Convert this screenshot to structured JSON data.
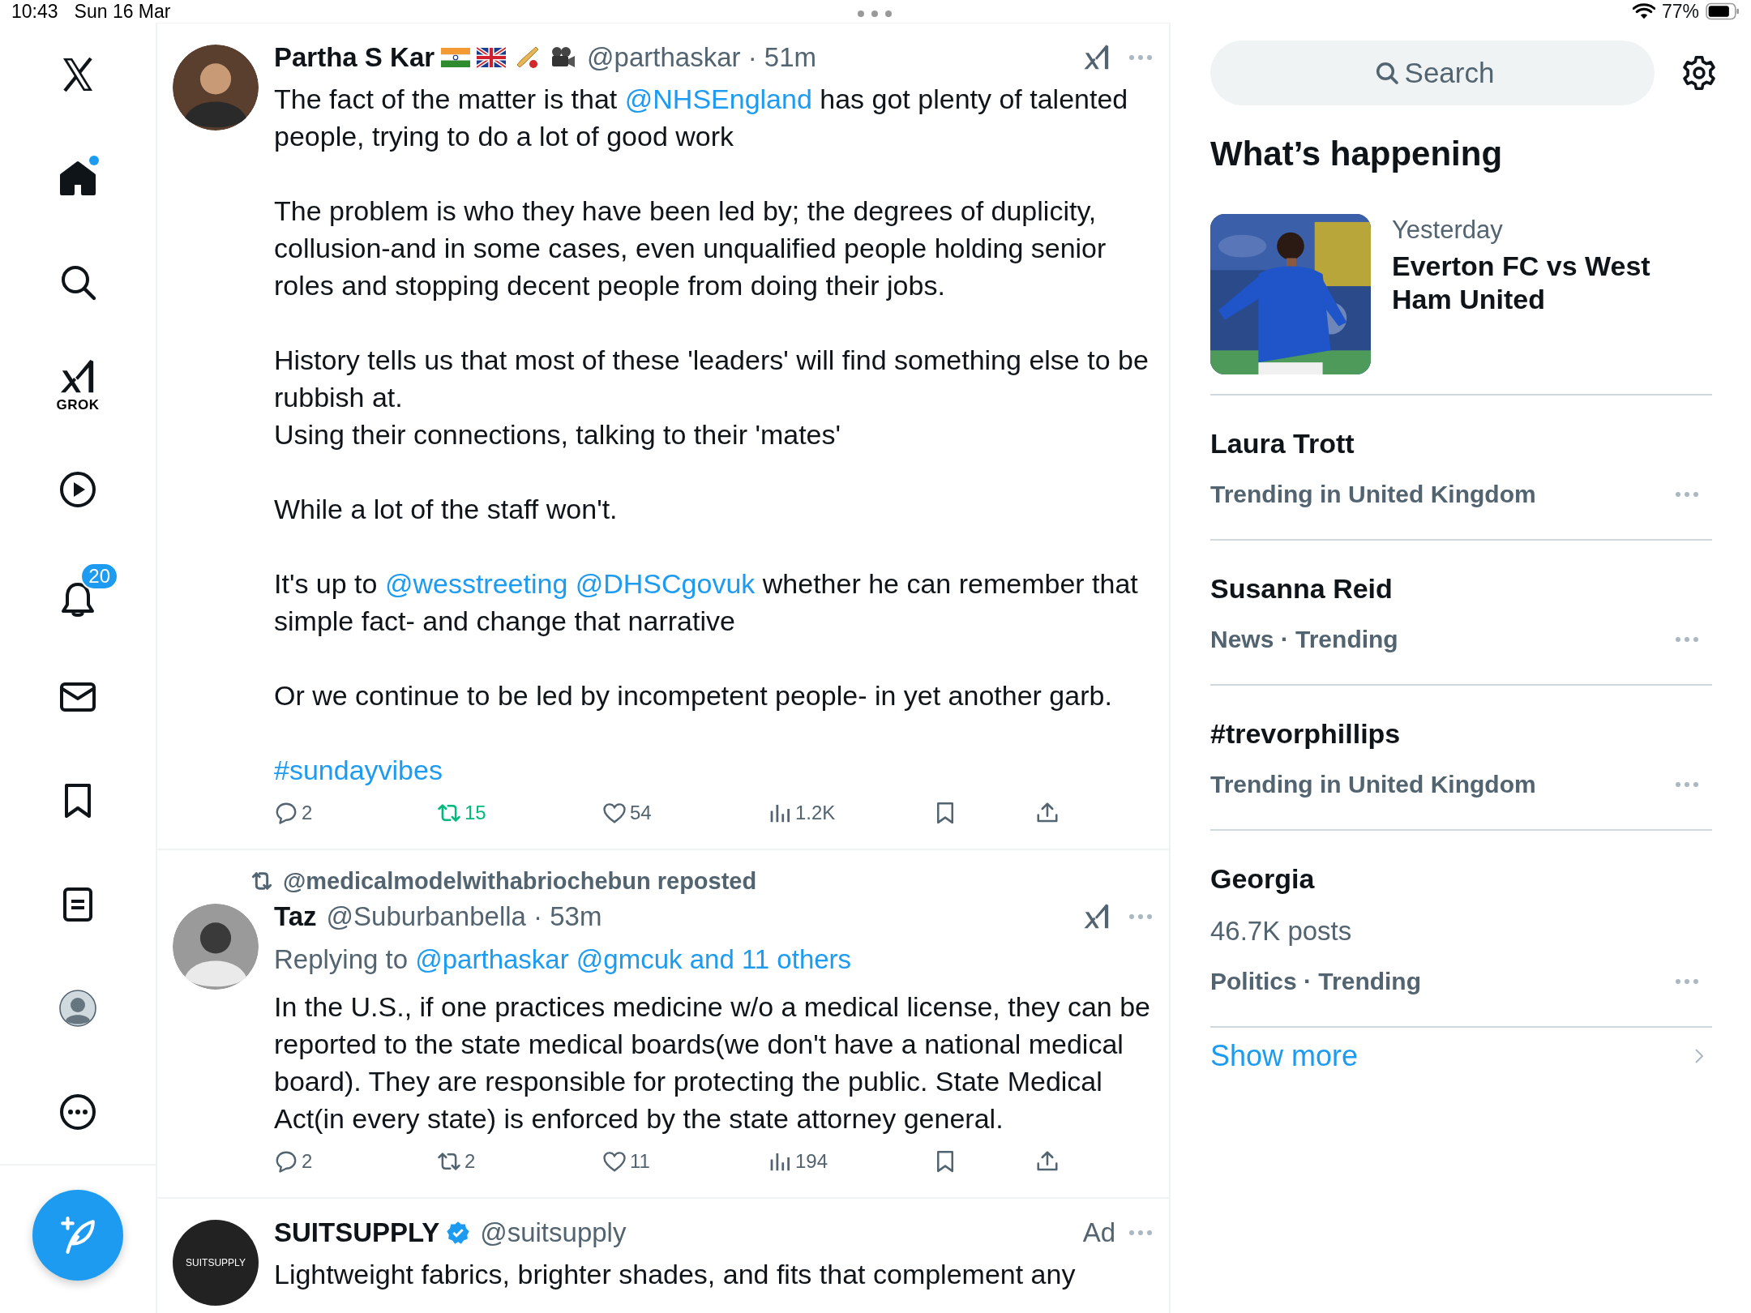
{
  "status_bar": {
    "time": "10:43",
    "date": "Sun 16 Mar",
    "battery": "77%"
  },
  "nav": [
    {
      "kind": "home",
      "selected": true,
      "unread": true
    },
    {
      "kind": "search",
      "selected": false
    },
    {
      "kind": "grok",
      "selected": false,
      "label": "GROK"
    },
    {
      "kind": "video",
      "selected": false
    },
    {
      "kind": "notifications",
      "selected": false,
      "badge": "20"
    },
    {
      "kind": "messages",
      "selected": false
    },
    {
      "kind": "bookmarks",
      "selected": false
    },
    {
      "kind": "lists",
      "selected": false
    },
    {
      "kind": "profile",
      "selected": false
    },
    {
      "kind": "more",
      "selected": false
    }
  ],
  "timeline": [
    {
      "kind": "post",
      "name": "Partha S Kar",
      "name_badges": [
        {
          "kind": "flag-india"
        },
        {
          "kind": "flag-uk"
        },
        {
          "kind": "cricket"
        },
        {
          "kind": "movie-camera"
        }
      ],
      "handle": "@parthaskar · 51m",
      "body": [
        {
          "lines": [
            [
              {
                "text": "The fact of the matter is that ",
                "link": false
              },
              {
                "text": "@NHSEngland",
                "link": true
              },
              {
                "text": " has got plenty of talented people, trying to do a lot of good work",
                "link": false
              }
            ]
          ]
        },
        {
          "lines": [
            [
              {
                "text": "The problem is who they have been led by; the degrees of duplicity, collusion-and in some cases, even unqualified people holding senior roles and stopping decent people from doing their jobs.",
                "link": false
              }
            ]
          ]
        },
        {
          "lines": [
            [
              {
                "text": "History tells us that most of these 'leaders' will find something else to be rubbish at.",
                "link": false
              }
            ],
            [
              {
                "text": "Using their connections, talking to their 'mates'",
                "link": false
              }
            ]
          ]
        },
        {
          "lines": [
            [
              {
                "text": "While a lot of the staff won't.",
                "link": false
              }
            ]
          ]
        },
        {
          "lines": [
            [
              {
                "text": "It's up to ",
                "link": false
              },
              {
                "text": "@wesstreeting @DHSCgovuk",
                "link": true
              },
              {
                "text": " whether he can remember that simple fact- and change that narrative",
                "link": false
              }
            ]
          ]
        },
        {
          "lines": [
            [
              {
                "text": "Or we continue to be led by incompetent people- in yet another garb.",
                "link": false
              }
            ]
          ]
        },
        {
          "lines": [
            [
              {
                "text": "#sundayvibes",
                "link": true
              }
            ]
          ]
        }
      ],
      "reposted": true,
      "stats": {
        "replies": "2",
        "reposts": "15",
        "likes": "54",
        "views": "1.2K"
      }
    },
    {
      "kind": "post",
      "reposted_by": "@medicalmodelwithabriochebun reposted",
      "name": "Taz",
      "handle": "@Suburbanbella · 53m",
      "replying_to": [
        {
          "text": "Replying to ",
          "link": false
        },
        {
          "text": "@parthaskar @gmcuk and 11 others",
          "link": true
        }
      ],
      "body": [
        {
          "lines": [
            [
              {
                "text": "In the U.S., if one practices medicine w/o a medical license, they can be reported to the state medical boards(we don't have a national medical board). They are responsible for protecting the public. State Medical Act(in every state) is enforced by the state attorney general.",
                "link": false
              }
            ]
          ]
        }
      ],
      "reposted": false,
      "stats": {
        "replies": "2",
        "reposts": "2",
        "likes": "11",
        "views": "194"
      }
    },
    {
      "kind": "ad",
      "name": "SUITSUPPLY",
      "avatar_text": "SUITSUPPLY",
      "verified": true,
      "handle": "@suitsupply",
      "ad_label": "Ad",
      "body": [
        {
          "lines": [
            [
              {
                "text": "Lightweight fabrics, brighter shades, and fits that complement any",
                "link": false
              }
            ]
          ]
        }
      ]
    }
  ],
  "sidebar": {
    "search": {
      "placeholder": "Search"
    },
    "heading": "What’s happening",
    "trends": [
      {
        "kind": "event",
        "time": "Yesterday",
        "title": "Everton FC vs West Ham United"
      },
      {
        "kind": "trend",
        "name": "Laura Trott",
        "context": "Trending in United Kingdom"
      },
      {
        "kind": "trend",
        "name": "Susanna Reid",
        "context": "News · Trending"
      },
      {
        "kind": "trend",
        "name": "#trevorphillips",
        "context": "Trending in United Kingdom"
      },
      {
        "kind": "trend",
        "name": "Georgia",
        "posts": "46.7K posts",
        "context": "Politics · Trending"
      }
    ],
    "show_more": "Show more"
  }
}
